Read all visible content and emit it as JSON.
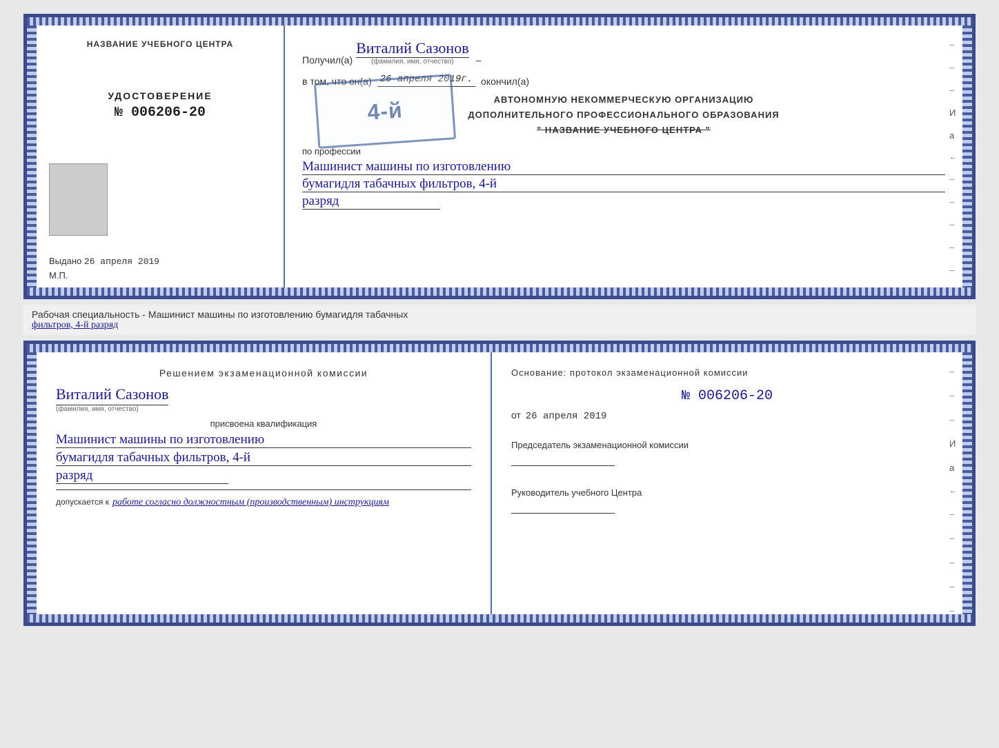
{
  "top_cert": {
    "left": {
      "title": "НАЗВАНИЕ УЧЕБНОГО ЦЕНТРА",
      "udostoverenie_label": "УДОСТОВЕРЕНИЕ",
      "cert_number": "№ 006206-20",
      "vydano_label": "Выдано",
      "vydano_date": "26 апреля 2019",
      "mp_label": "М.П."
    },
    "right": {
      "poluchil_prefix": "Получил(а)",
      "recipient_name": "Виталий Сазонов",
      "recipient_name_sublabel": "(фамилия, имя, отчество)",
      "dash": "–",
      "vtom_prefix": "в том, что он(а)",
      "vtom_date": "26 апреля 2019г.",
      "okonchil": "окончил(а)",
      "org_line1": "АВТОНОМНУЮ НЕКОММЕРЧЕСКУЮ ОРГАНИЗАЦИЮ",
      "org_line2": "ДОПОЛНИТЕЛЬНОГО ПРОФЕССИОНАЛЬНОГО ОБРАЗОВАНИЯ",
      "org_line3": "\" НАЗВАНИЕ УЧЕБНОГО ЦЕНТРА \"",
      "po_professii": "по профессии",
      "profession_line1": "Машинист машины по изготовлению",
      "profession_line2": "бумагидля табачных фильтров, 4-й",
      "profession_line3": "разряд"
    }
  },
  "stamp": {
    "text": "4-й"
  },
  "middle": {
    "text": "Рабочая специальность - Машинист машины по изготовлению бумагидля табачных",
    "text2": "фильтров, 4-й разряд"
  },
  "bottom_cert": {
    "left": {
      "resheniem": "Решением экзаменационной комиссии",
      "fio": "Виталий Сазонов",
      "fio_sublabel": "(фамилия, имя, отчество)",
      "prisvoyena": "присвоена квалификация",
      "qual_line1": "Машинист машины по изготовлению",
      "qual_line2": "бумагидля табачных фильтров, 4-й",
      "qual_line3": "разряд",
      "dopuskaetsya_prefix": "допускается к",
      "dopuskaetsya_text": "работе согласно должностным (производственным) инструкциям"
    },
    "right": {
      "osnovaniye": "Основание: протокол экзаменационной комиссии",
      "protocol_number": "№ 006206-20",
      "ot_prefix": "от",
      "ot_date": "26 апреля 2019",
      "predsedatel_label": "Председатель экзаменационной комиссии",
      "rukovoditel_label": "Руководитель учебного Центра"
    }
  },
  "dashes": [
    "–",
    "–",
    "–",
    "И",
    "а",
    "←",
    "–",
    "–",
    "–",
    "–",
    "–",
    "–"
  ]
}
